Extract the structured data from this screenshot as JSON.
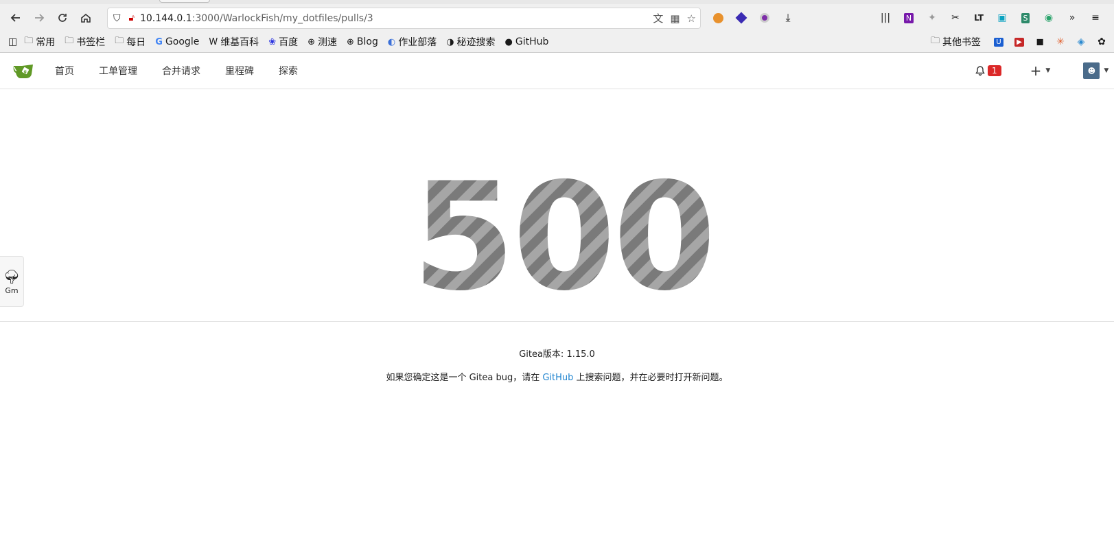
{
  "browser": {
    "url_host": "10.144.0.1",
    "url_path": ":3000/WarlockFish/my_dotfiles/pulls/3"
  },
  "bookmarks": [
    {
      "label": "常用",
      "icon": "folder-icon"
    },
    {
      "label": "书签栏",
      "icon": "folder-icon"
    },
    {
      "label": "每日",
      "icon": "folder-icon"
    },
    {
      "label": "Google",
      "icon": "google-icon"
    },
    {
      "label": "维基百科",
      "icon": "wikipedia-icon"
    },
    {
      "label": "百度",
      "icon": "baidu-icon"
    },
    {
      "label": "测速",
      "icon": "globe-icon"
    },
    {
      "label": "Blog",
      "icon": "globe-icon"
    },
    {
      "label": "作业部落",
      "icon": "zybuluo-icon"
    },
    {
      "label": "秘迹搜索",
      "icon": "mijisou-icon"
    },
    {
      "label": "GitHub",
      "icon": "github-icon"
    }
  ],
  "bookmarks_other": "其他书签",
  "gitea": {
    "nav": [
      "首页",
      "工单管理",
      "合并请求",
      "里程碑",
      "探索"
    ],
    "notification_count": "1"
  },
  "error": {
    "code": "500",
    "version_text": "Gitea版本: 1.15.0",
    "msg_before": "如果您确定这是一个 Gitea bug，请在 ",
    "msg_link": "GitHub",
    "msg_after": " 上搜索问题，并在必要时打开新问题。"
  },
  "side_widget": {
    "label": "Gm"
  }
}
